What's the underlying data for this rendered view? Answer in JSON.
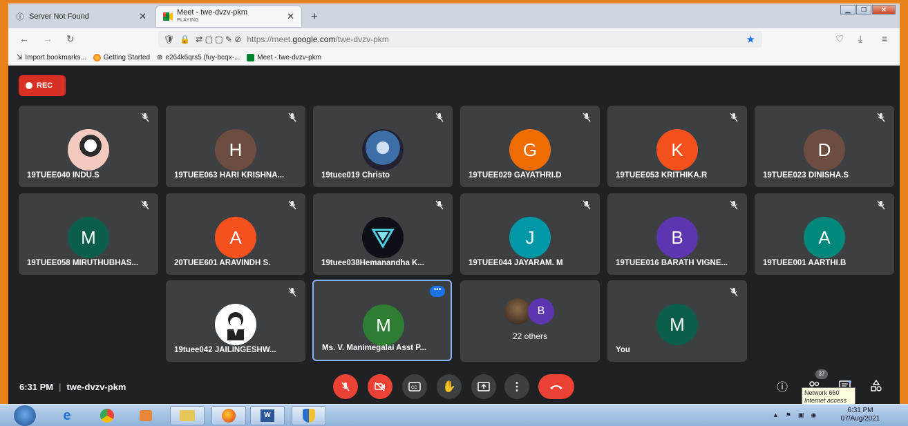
{
  "browser": {
    "tabs": [
      {
        "title": "Server Not Found"
      },
      {
        "title": "Meet - twe-dvzv-pkm",
        "status": "PLAYING"
      }
    ],
    "url_prefix": "https://meet.",
    "url_domain": "google.com",
    "url_path": "/twe-dvzv-pkm",
    "bookmarks": [
      "Import bookmarks...",
      "Getting Started",
      "e264k6qrs5 (fuy-bcqx-...",
      "Meet - twe-dvzv-pkm"
    ]
  },
  "meet": {
    "rec_label": "REC",
    "participants": [
      {
        "name": "19TUEE040 INDU.S",
        "initial": "",
        "color": "#f3c9c0",
        "photo": true
      },
      {
        "name": "19TUEE063 HARI KRISHNA...",
        "initial": "H",
        "color": "#6d4c41"
      },
      {
        "name": "19tuee019 Christo",
        "initial": "",
        "color": "#5b7fa8",
        "photo": true
      },
      {
        "name": "19TUEE029 GAYATHRI.D",
        "initial": "G",
        "color": "#ef6c00"
      },
      {
        "name": "19TUEE053 KRITHIKA.R",
        "initial": "K",
        "color": "#f4511e"
      },
      {
        "name": "19TUEE023 DINISHA.S",
        "initial": "D",
        "color": "#6d4c41"
      },
      {
        "name": "19TUEE058 MIRUTHUBHAS...",
        "initial": "M",
        "color": "#0b5e4a"
      },
      {
        "name": "20TUEE601 ARAVINDH S.",
        "initial": "A",
        "color": "#f4511e"
      },
      {
        "name": "19tuee038Hemanandha K...",
        "initial": "",
        "color": "#0d1117",
        "photo": true
      },
      {
        "name": "19TUEE044 JAYARAM. M",
        "initial": "J",
        "color": "#0097a7"
      },
      {
        "name": "19TUEE016 BARATH VIGNE...",
        "initial": "B",
        "color": "#5e35b1"
      },
      {
        "name": "19TUEE001 AARTHI.B",
        "initial": "A",
        "color": "#00897b"
      },
      {
        "name": "19tuee042 JAILINGESHW...",
        "initial": "",
        "color": "#ffffff",
        "photo": true
      },
      {
        "name": "Ms. V. Manimegalai Asst P...",
        "initial": "M",
        "color": "#2e7d32"
      },
      {
        "name": "You",
        "initial": "M",
        "color": "#0b5e4a"
      }
    ],
    "others": {
      "avatar_initial": "B",
      "label": "22 others"
    },
    "time": "6:31 PM",
    "meeting_code": "twe-dvzv-pkm",
    "people_count": "37"
  },
  "tooltip": {
    "title": "Network  660",
    "subtitle": "Internet access"
  },
  "taskbar": {
    "time": "6:31 PM",
    "date": "07/Aug/2021"
  }
}
